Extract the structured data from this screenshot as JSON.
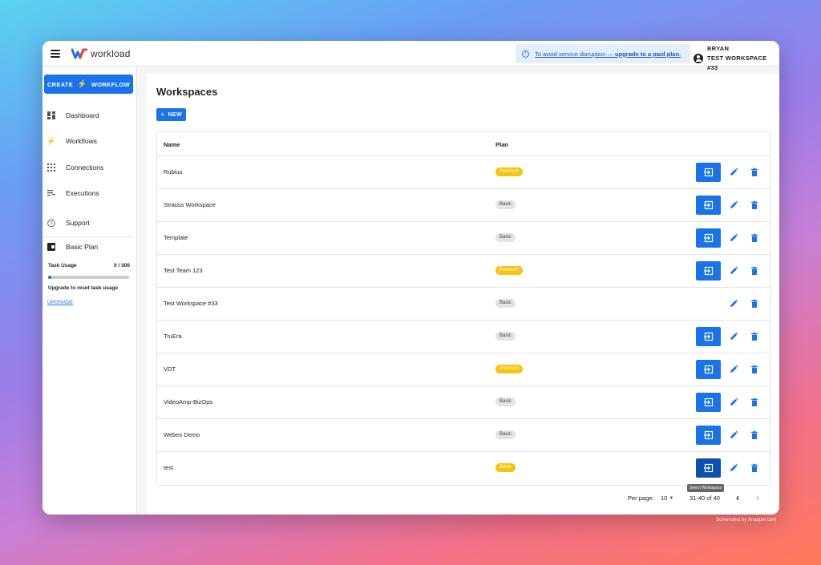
{
  "app": {
    "logo_text": "workload",
    "notice_text": "To avoid service disruption — ",
    "notice_link": "upgrade to a paid plan.",
    "user_name": "BRYAN",
    "workspace_name": "TEST WORKSPACE #33"
  },
  "sidebar": {
    "create_left": "CREATE",
    "create_right": "WORKFLOW",
    "items": [
      {
        "label": "Dashboard",
        "icon": "dashboard-icon"
      },
      {
        "label": "Workflows",
        "icon": "workflows-icon"
      },
      {
        "label": "Connections",
        "icon": "connections-icon"
      },
      {
        "label": "Executions",
        "icon": "executions-icon"
      },
      {
        "label": "Support",
        "icon": "help-icon"
      }
    ],
    "plan_title": "Basic Plan",
    "usage_label": "Task Usage",
    "usage_value": "0 / 300",
    "usage_fraction": 0.0,
    "upgrade_note": "Upgrade to reset task usage",
    "upgrade_link": "UPGRADE"
  },
  "main": {
    "title": "Workspaces",
    "new_button": "NEW",
    "columns": {
      "name": "Name",
      "plan": "Plan"
    },
    "rows": [
      {
        "name": "Rubius",
        "plan": "Premium",
        "has_enter": true
      },
      {
        "name": "Strauss Workspace",
        "plan": "Basic",
        "has_enter": true
      },
      {
        "name": "Template",
        "plan": "Basic",
        "has_enter": true
      },
      {
        "name": "Test Team 123",
        "plan": "Premium",
        "has_enter": true
      },
      {
        "name": "Test Workspace #33",
        "plan": "Basic",
        "has_enter": false
      },
      {
        "name": "TruEra",
        "plan": "Basic",
        "has_enter": true
      },
      {
        "name": "VDT",
        "plan": "Premium",
        "has_enter": true
      },
      {
        "name": "VideoAmp-BizOps",
        "plan": "Basic",
        "has_enter": true
      },
      {
        "name": "Webex Demo",
        "plan": "Basic",
        "has_enter": true
      },
      {
        "name": "test",
        "plan": "Basic",
        "plan_style": "premium",
        "has_enter": true,
        "enter_active": true
      }
    ],
    "tooltip": "Select Workspace",
    "per_page_label": "Per page:",
    "per_page_value": "10",
    "range": "31-40 of 40"
  },
  "credit": "Screenshot by Xnapper.com",
  "colors": {
    "accent": "#1a73e8",
    "premium": "#f6c40e",
    "basic": "#e3e3e3"
  }
}
